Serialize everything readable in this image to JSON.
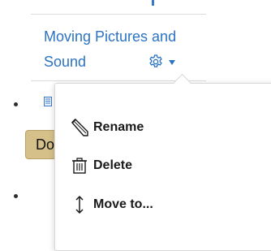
{
  "module": {
    "title_line1": "Moving Pictures and",
    "title_line2": "Sound"
  },
  "background": {
    "button_label": "Do"
  },
  "menu": {
    "items": [
      {
        "label": "Rename",
        "icon": "pencil-icon"
      },
      {
        "label": "Delete",
        "icon": "trash-icon"
      },
      {
        "label": "Move to...",
        "icon": "move-vertical-icon"
      }
    ]
  },
  "colors": {
    "link": "#2c73c4",
    "button_bg": "#d6c08a",
    "text": "#1a1a1a"
  }
}
